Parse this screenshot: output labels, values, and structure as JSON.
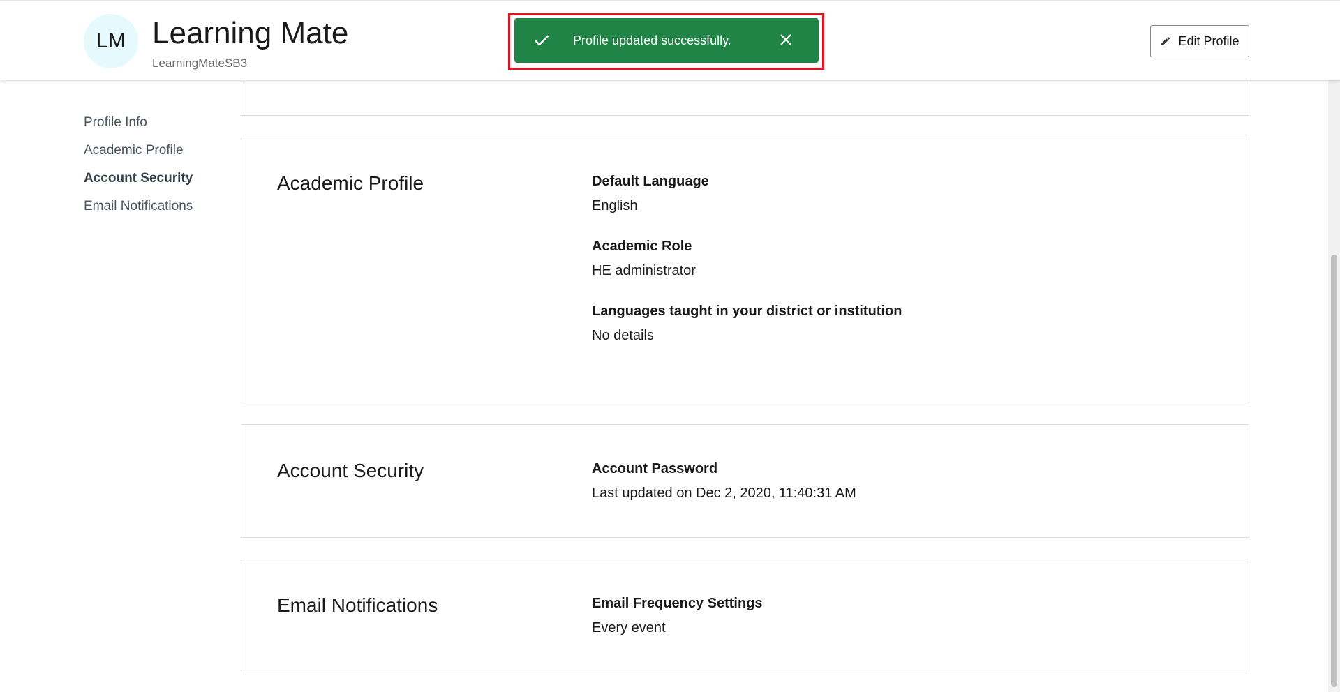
{
  "header": {
    "avatar_initials": "LM",
    "user_name": "Learning Mate",
    "user_handle": "LearningMateSB3",
    "edit_button_label": "Edit Profile"
  },
  "toast": {
    "message": "Profile updated successfully.",
    "background_color": "#1f8445",
    "highlight_color": "#e0141e"
  },
  "sidebar": {
    "items": [
      {
        "label": "Profile Info",
        "active": false
      },
      {
        "label": "Academic Profile",
        "active": false
      },
      {
        "label": "Account Security",
        "active": true
      },
      {
        "label": "Email Notifications",
        "active": false
      }
    ]
  },
  "sections": {
    "academic": {
      "title": "Academic Profile",
      "fields": [
        {
          "label": "Default Language",
          "value": "English"
        },
        {
          "label": "Academic Role",
          "value": "HE administrator"
        },
        {
          "label": "Languages taught in your district or institution",
          "value": "No details"
        }
      ]
    },
    "security": {
      "title": "Account Security",
      "fields": [
        {
          "label": "Account Password",
          "value": "Last updated on Dec 2, 2020, 11:40:31 AM"
        }
      ]
    },
    "email": {
      "title": "Email Notifications",
      "fields": [
        {
          "label": "Email Frequency Settings",
          "value": "Every event"
        }
      ]
    }
  },
  "icons": {
    "toast_status": "check-icon",
    "toast_close": "close-icon",
    "edit": "pencil-icon"
  }
}
